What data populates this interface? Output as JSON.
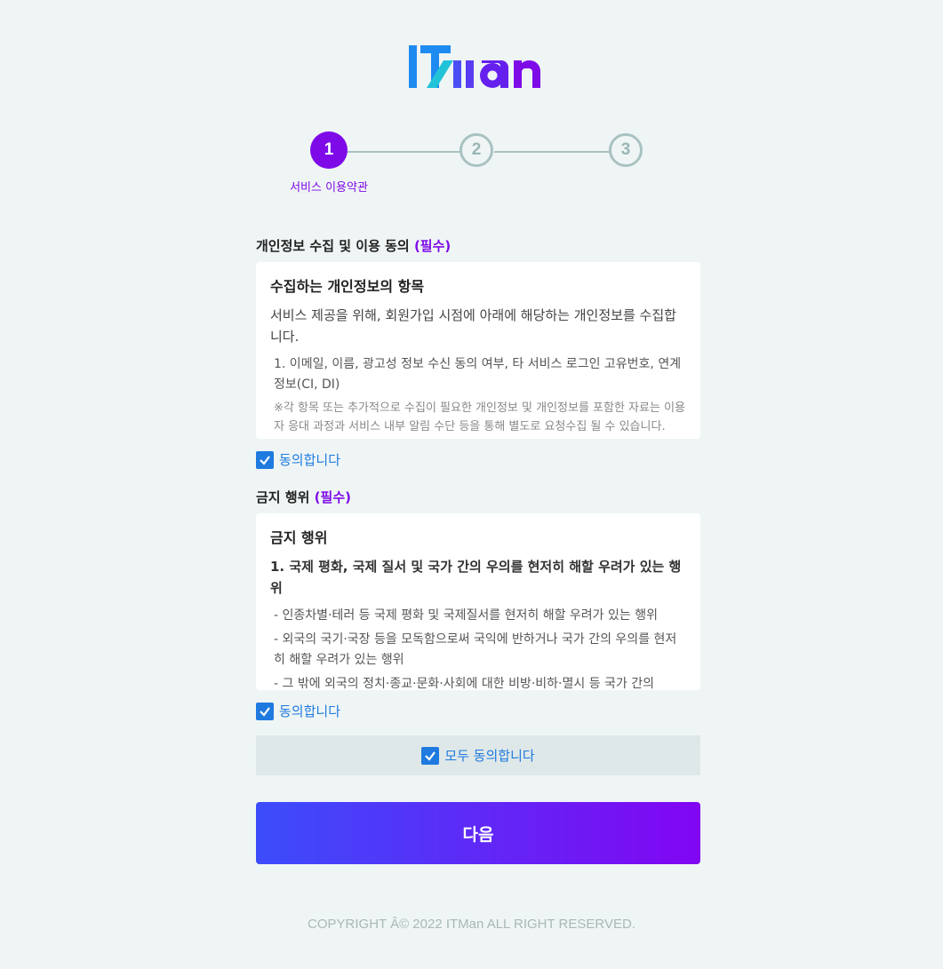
{
  "brand": {
    "logo_text": "ITMan",
    "colors": {
      "logo_blue": "#1f8bf0",
      "logo_purple": "#7e0ae8",
      "accent": "#7e0ae8",
      "link": "#1f7ae0"
    }
  },
  "stepper": {
    "steps": [
      {
        "number": "1",
        "label": "서비스 이용약관",
        "state": "active"
      },
      {
        "number": "2",
        "label": "",
        "state": "inactive"
      },
      {
        "number": "3",
        "label": "",
        "state": "inactive"
      }
    ]
  },
  "privacy": {
    "title": "개인정보 수집 및 이용 동의",
    "required": "(필수)",
    "box_heading": "수집하는 개인정보의 항목",
    "lead": "서비스 제공을 위해, 회원가입 시점에 아래에 해당하는 개인정보를 수집합니다.",
    "item1": "1. 이메일, 이름, 광고성 정보 수신 동의 여부, 타 서비스 로그인 고유번호, 연계정보(CI, DI)",
    "note": "※각 항목 또는 추가적으로 수집이 필요한 개인정보 및 개인정보를 포함한 자료는 이용자 응대 과정과 서비스 내부 알림 수단 등을 통해 별도로 요청수집 될 수 있습니다.",
    "agree_label": "동의합니다",
    "agreed": true
  },
  "prohibited": {
    "title": "금지 행위",
    "required": "(필수)",
    "box_heading": "금지 행위",
    "lead": "1. 국제 평화, 국제 질서 및 국가 간의 우의를 현저히 해할 우려가 있는 행위",
    "item1": "- 인종차별·테러 등 국제 평화 및 국제질서를 현저히 해할 우려가 있는 행위",
    "item2": "- 외국의 국기·국장 등을 모독함으로써 국익에 반하거나 국가 간의 우의를 현저히 해할 우려가 있는 행위",
    "item3": "- 그 밖에 외국의 정치·종교·문화·사회에 대한 비방·비하·멸시 등 국가 간의",
    "agree_label": "동의합니다",
    "agreed": true
  },
  "agree_all": {
    "label": "모두 동의합니다",
    "checked": true
  },
  "next_button": {
    "label": "다음"
  },
  "footer": {
    "copyright": "COPYRIGHT Â© 2022 ITMan ALL RIGHT RESERVED."
  }
}
